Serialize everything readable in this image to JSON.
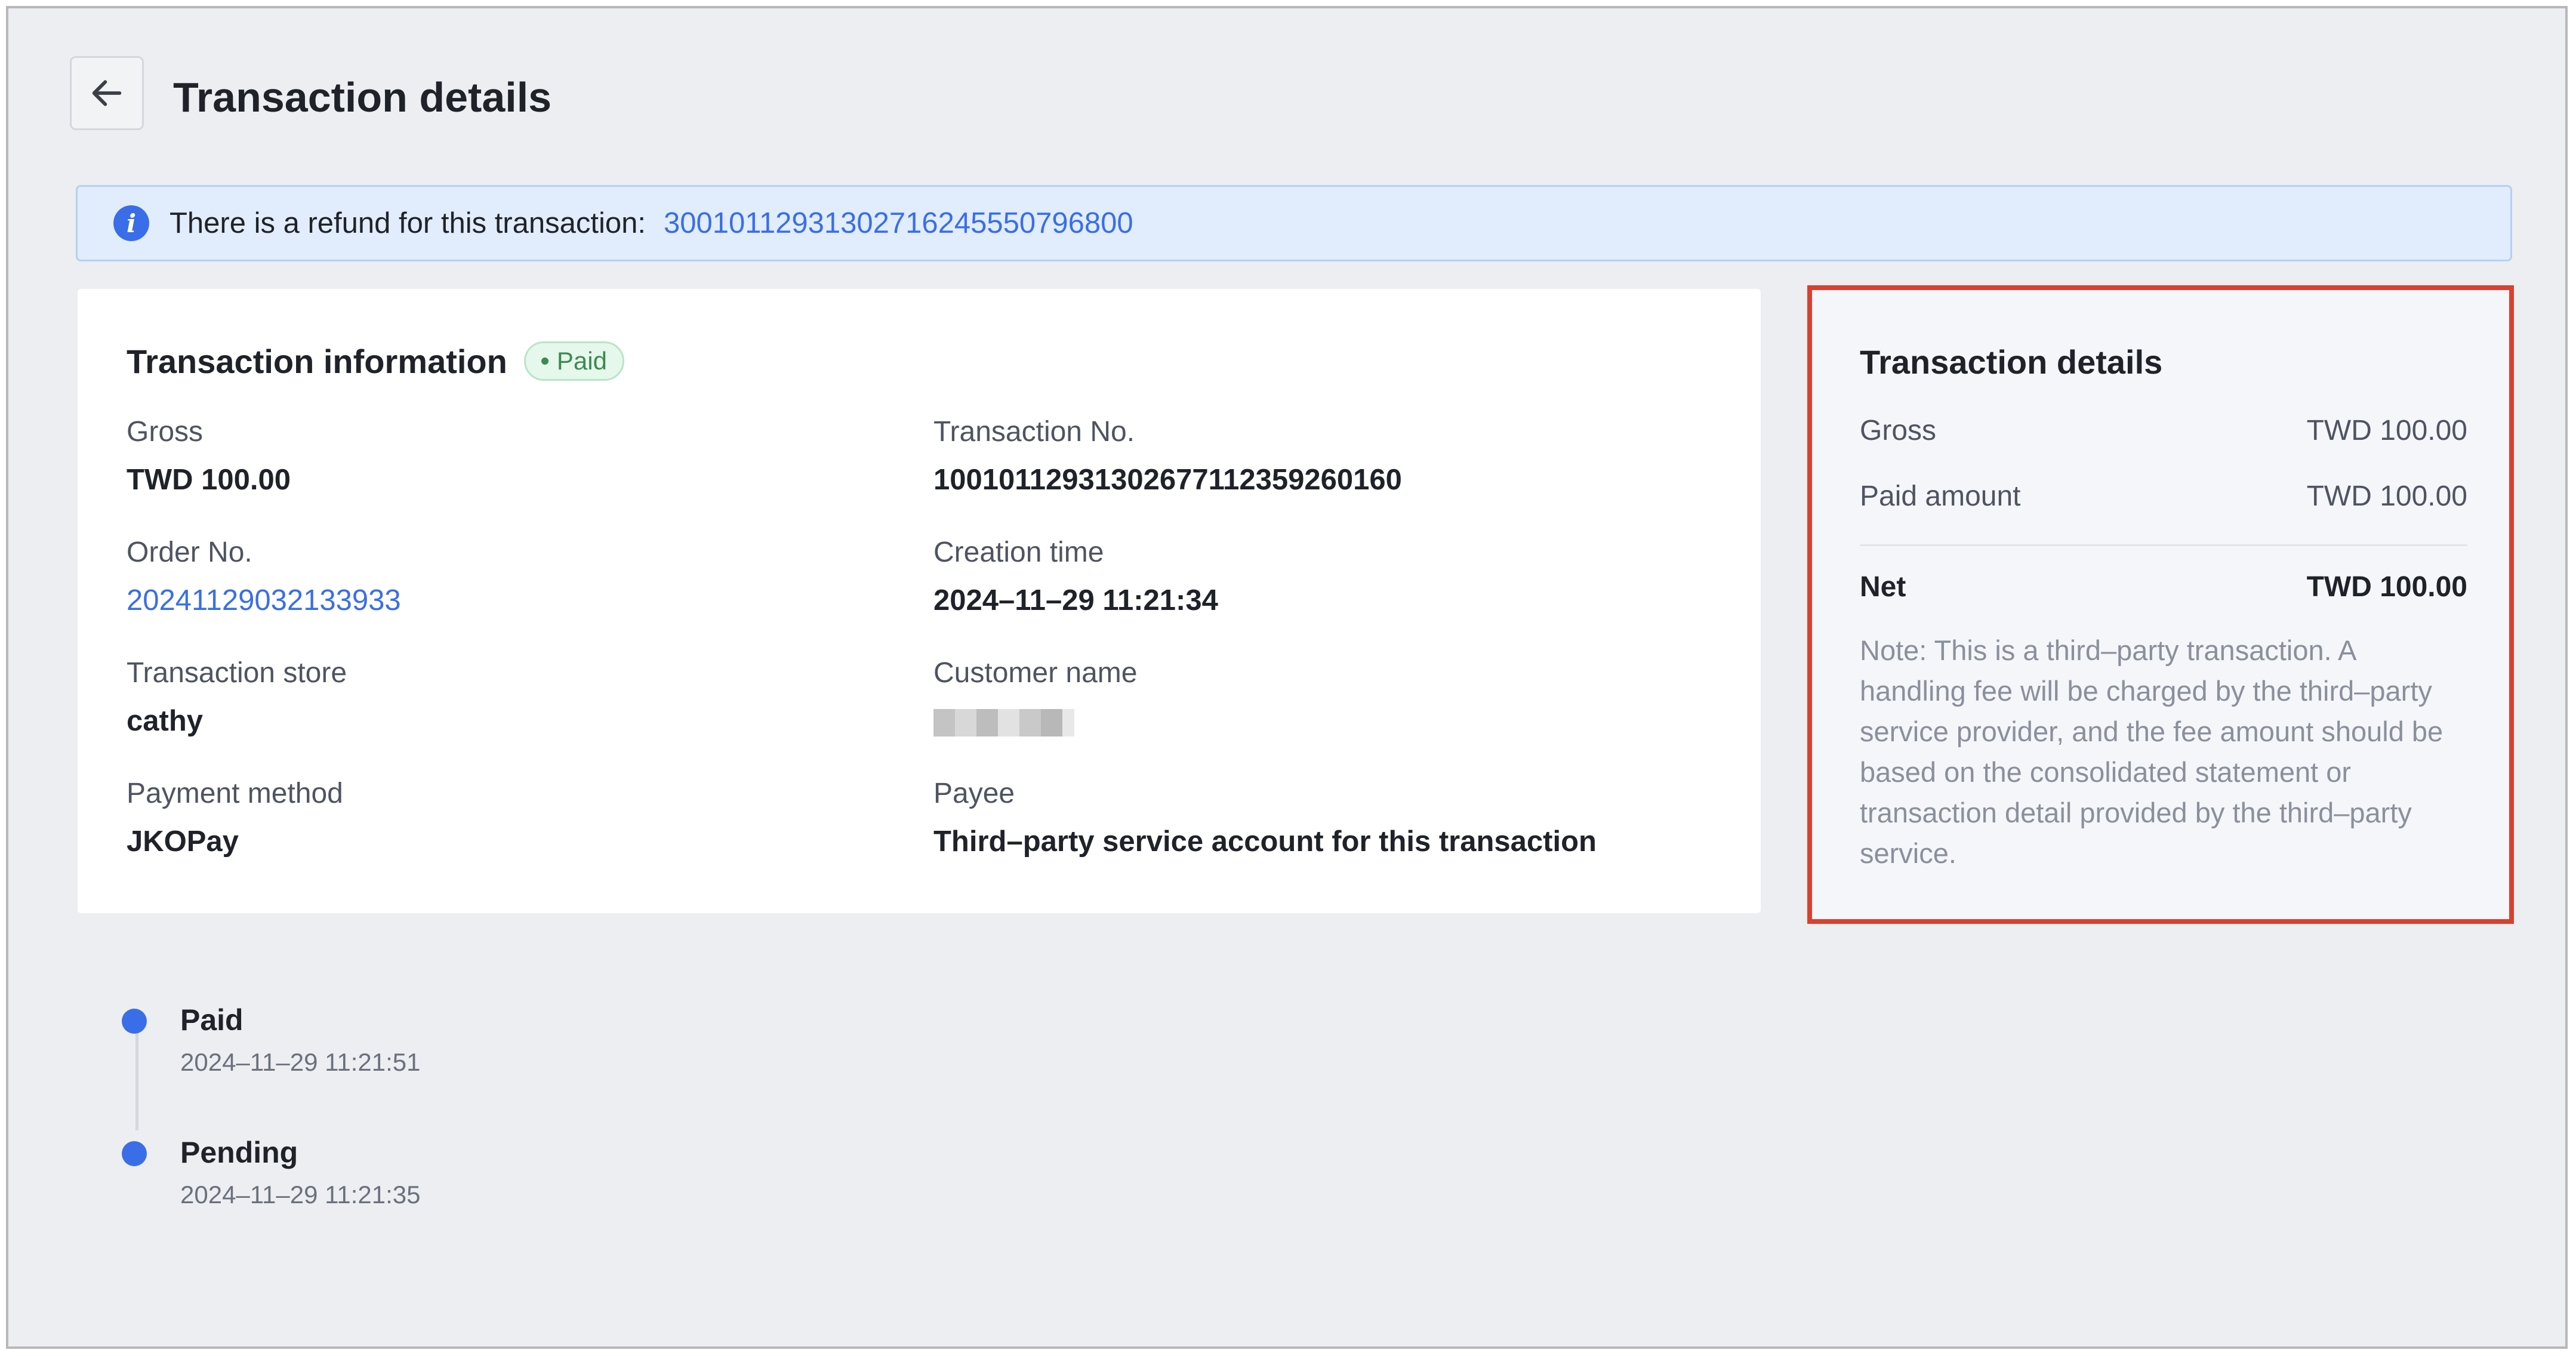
{
  "header": {
    "back_icon": "arrow-left-icon",
    "title": "Transaction details"
  },
  "banner": {
    "icon": "info-icon",
    "icon_glyph": "i",
    "text": "There is a refund for this transaction:",
    "refund_no": "3001011293130271624555079680​0"
  },
  "info": {
    "title": "Transaction information",
    "status_badge": "Paid",
    "fields": {
      "gross": {
        "label": "Gross",
        "value": "TWD 100.00"
      },
      "transaction_no": {
        "label": "Transaction No.",
        "value": "1001011293130267711235926016​0"
      },
      "order_no": {
        "label": "Order No.",
        "value": "20241129032133933"
      },
      "creation_time": {
        "label": "Creation time",
        "value": "2024–11–29 11:21:34"
      },
      "store": {
        "label": "Transaction store",
        "value": "cathy"
      },
      "customer_name": {
        "label": "Customer name"
      },
      "payment_method": {
        "label": "Payment method",
        "value": "JKOPay"
      },
      "payee": {
        "label": "Payee",
        "value": "Third–party service account for this transaction"
      }
    }
  },
  "details": {
    "title": "Transaction details",
    "gross_label": "Gross",
    "gross_value": "TWD 100.00",
    "paid_label": "Paid amount",
    "paid_value": "TWD 100.00",
    "net_label": "Net",
    "net_value": "TWD 100.00",
    "note": "Note: This is a third–party transaction. A handling fee will be charged by the third–party service provider, and the fee amount should be based on the consolidated statement or transaction detail provided by the third–party service."
  },
  "timeline": [
    {
      "status": "Paid",
      "time": "2024–11–29 11:21:51"
    },
    {
      "status": "Pending",
      "time": "2024–11–29 11:21:35"
    }
  ],
  "colors": {
    "accent": "#3a6ee8",
    "highlight_border": "#d8412f",
    "paid_badge": "#3c8a52"
  }
}
